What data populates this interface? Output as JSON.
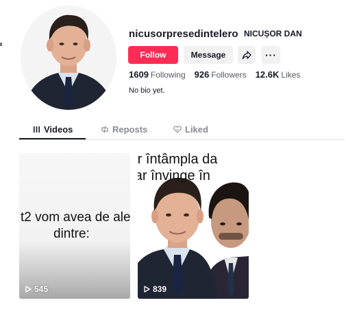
{
  "profile": {
    "username": "nicusorpresedintelero",
    "display_name": "NICUȘOR DAN",
    "follow_label": "Follow",
    "message_label": "Message",
    "more_label": "···",
    "stats": {
      "following_count": "1609",
      "following_label": "Following",
      "followers_count": "926",
      "followers_label": "Followers",
      "likes_count": "12.6K",
      "likes_label": "Likes"
    },
    "bio": "No bio yet."
  },
  "tabs": [
    {
      "label": "Videos",
      "icon": "grid-icon",
      "active": true
    },
    {
      "label": "Reposts",
      "icon": "repost-icon",
      "active": false
    },
    {
      "label": "Liked",
      "icon": "heart-outline-icon",
      "active": false
    }
  ],
  "videos": [
    {
      "caption_line1": "t2 vom avea de ale",
      "caption_line2": "dintre:",
      "views": "545"
    },
    {
      "caption_line1": "s ar întâmpla da",
      "caption_line2": "on ar învinge în",
      "views": "839"
    }
  ],
  "colors": {
    "accent": "#fe2c55",
    "button_bg": "#f1f1f2",
    "text_primary": "#161823",
    "text_secondary": "#8a8b91"
  }
}
